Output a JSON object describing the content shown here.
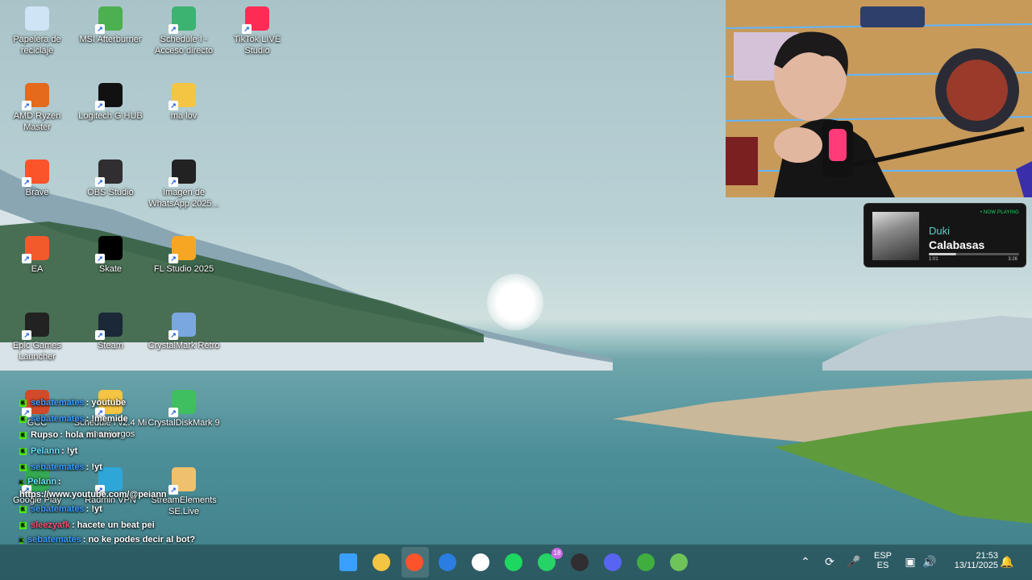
{
  "desktop": {
    "icons": [
      {
        "label": "Papelera de reciclaje",
        "icon": "recycle-bin-icon",
        "color": "#cfe4f5"
      },
      {
        "label": "MSI Afterburner",
        "icon": "msi-afterburner-icon",
        "color": "#4caf50"
      },
      {
        "label": "Schedule I - Acceso directo",
        "icon": "schedule-i-icon",
        "color": "#3cb371"
      },
      {
        "label": "TikTok LIVE Studio",
        "icon": "tiktok-live-icon",
        "color": "#fe2c55"
      },
      {
        "label": "AMD Ryzen Master",
        "icon": "amd-ryzen-icon",
        "color": "#e36b1b"
      },
      {
        "label": "Logitech G HUB",
        "icon": "logitech-g-icon",
        "color": "#111111"
      },
      {
        "label": "ma lov",
        "icon": "folder-icon",
        "color": "#f4c542"
      },
      {
        "label": "Brave",
        "icon": "brave-icon",
        "color": "#fb542b"
      },
      {
        "label": "OBS Studio",
        "icon": "obs-icon",
        "color": "#302e31"
      },
      {
        "label": "Imagen de WhatsApp 2025...",
        "icon": "image-file-icon",
        "color": "#222222"
      },
      {
        "label": "EA",
        "icon": "ea-icon",
        "color": "#f35a2b"
      },
      {
        "label": "Skate",
        "icon": "skate-icon",
        "color": "#000000"
      },
      {
        "label": "FL Studio 2025",
        "icon": "fl-studio-icon",
        "color": "#f6a623"
      },
      {
        "label": "Epic Games Launcher",
        "icon": "epic-games-icon",
        "color": "#222222"
      },
      {
        "label": "Steam",
        "icon": "steam-icon",
        "color": "#1b2838"
      },
      {
        "label": "CrystalMark Retro",
        "icon": "crystalmark-icon",
        "color": "#7aa7e0"
      },
      {
        "label": "GCC",
        "icon": "gcc-icon",
        "color": "#d14a2a"
      },
      {
        "label": "Schedule I v2.4 Mi amor juegos",
        "icon": "folder-icon",
        "color": "#f4c542"
      },
      {
        "label": "CrystalDiskMark 9",
        "icon": "crystaldiskmark-icon",
        "color": "#3fbf5f"
      },
      {
        "label": "Google Play",
        "icon": "google-play-icon",
        "color": "#34a853"
      },
      {
        "label": "Radmin VPN",
        "icon": "radmin-vpn-icon",
        "color": "#2fa6d8"
      },
      {
        "label": "StreamElements SE.Live",
        "icon": "streamelements-icon",
        "color": "#f0c16c"
      }
    ]
  },
  "now_playing": {
    "badge": "• NOW PLAYING",
    "artist": "Duki",
    "track": "Calabasas",
    "elapsed": "1:01",
    "duration": "3:26",
    "progress": 0.3
  },
  "chat": {
    "messages": [
      {
        "user": "sebatemates",
        "text": ": youtube",
        "color": "#3b9cff"
      },
      {
        "user": "sebatemates",
        "text": ": !memide",
        "color": "#3b9cff"
      },
      {
        "user": "Rupso",
        "text": ": hola mi amor",
        "color": "#ffffff"
      },
      {
        "user": "Pelann",
        "text": ": !yt",
        "color": "#66e0ff"
      },
      {
        "user": "sebatemates",
        "text": ": !yt",
        "color": "#3b9cff"
      },
      {
        "user": "Pelann",
        "text": ": https://www.youtube.com/@peiann",
        "color": "#66e0ff"
      },
      {
        "user": "sebatemates",
        "text": ": !yt",
        "color": "#3b9cff"
      },
      {
        "user": "sleezyafk",
        "text": ": hacete un beat pei",
        "color": "#ff4d6d"
      },
      {
        "user": "sebatemates",
        "text": ": no ke podes decir al bot?",
        "color": "#3b9cff"
      }
    ]
  },
  "taskbar": {
    "apps": [
      {
        "name": "windows-start-icon",
        "color": "#3aa0ff"
      },
      {
        "name": "file-explorer-icon",
        "color": "#f4c542"
      },
      {
        "name": "brave-taskbar-icon",
        "color": "#fb542b"
      },
      {
        "name": "microsoft-store-icon",
        "color": "#2a7de1"
      },
      {
        "name": "chatgpt-icon",
        "color": "#ffffff"
      },
      {
        "name": "spotify-icon",
        "color": "#1ed760"
      },
      {
        "name": "whatsapp-icon",
        "color": "#25d366"
      },
      {
        "name": "obs-taskbar-icon",
        "color": "#302e31"
      },
      {
        "name": "discord-icon",
        "color": "#5865f2"
      },
      {
        "name": "minecraft-icon",
        "color": "#3fae3f"
      },
      {
        "name": "minecraft-launcher-icon",
        "color": "#6ec45a"
      }
    ],
    "whatsapp_badge": "18",
    "language_top": "ESP",
    "language_bottom": "ES",
    "time": "21:53",
    "date": "13/11/2025"
  }
}
